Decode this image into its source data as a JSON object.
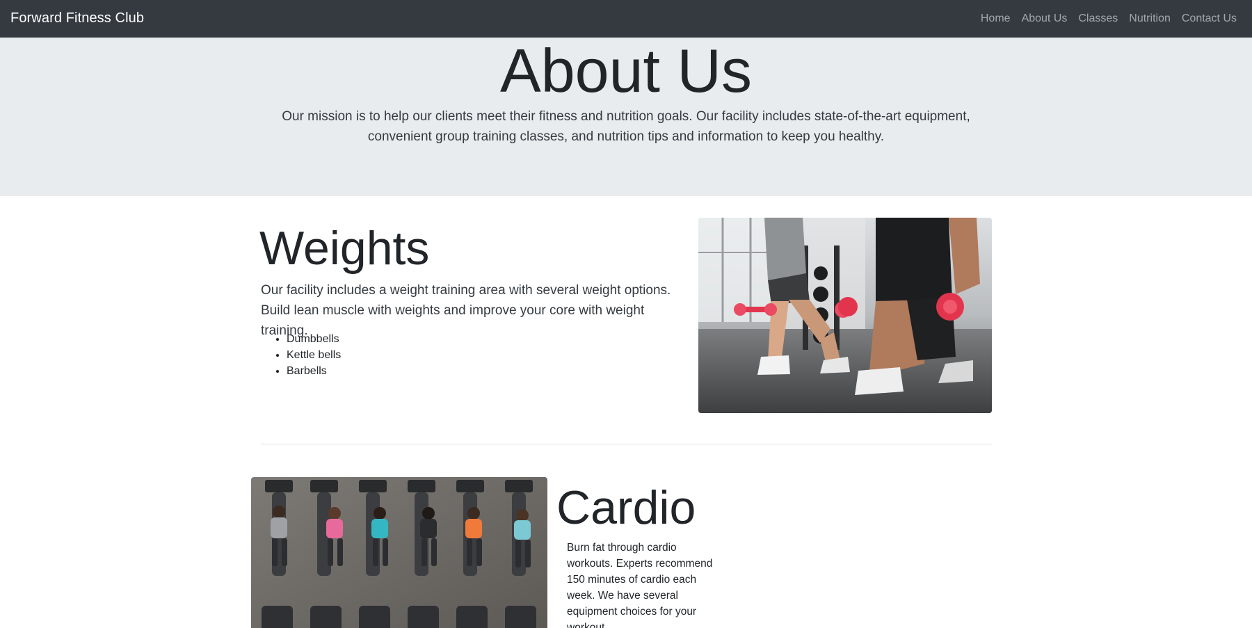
{
  "navbar": {
    "brand": "Forward Fitness Club",
    "links": [
      "Home",
      "About Us",
      "Classes",
      "Nutrition",
      "Contact Us"
    ],
    "background": "#343a40"
  },
  "jumbotron": {
    "title": "About Us",
    "lead": "Our mission is to help our clients meet their fitness and nutrition goals. Our facility includes state-of-the-art equipment, convenient group training classes, and nutrition tips and information to keep you healthy.",
    "background": "#e9ecef"
  },
  "weights": {
    "title": "Weights",
    "lead": "Our facility includes a weight training area with several weight options. Build lean muscle with weights and improve your core with weight training.",
    "items": [
      "Dumbbells",
      "Kettle bells",
      "Barbells"
    ]
  },
  "cardio": {
    "title": "Cardio",
    "text": "Burn fat through cardio workouts. Experts recommend 150 minutes of cardio each week. We have several equipment choices for your workout."
  }
}
